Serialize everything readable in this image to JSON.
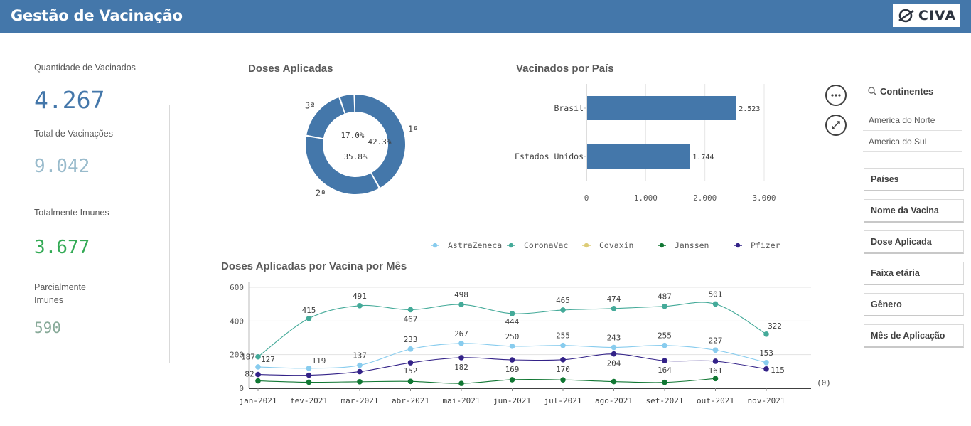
{
  "header": {
    "title": "Gestão de Vacinação",
    "logo_text": "CIVA"
  },
  "kpis": [
    {
      "label": "Quantidade de Vacinados",
      "value": "4.267",
      "color": "#4477aa"
    },
    {
      "label": "Total de Vacinações",
      "value": "9.042",
      "color": "#99bbcc"
    },
    {
      "label": "Totalmente Imunes",
      "value": "3.677",
      "color": "#33aa55"
    },
    {
      "label_line1": "Parcialmente",
      "label_line2": "Imunes",
      "value": "590",
      "color": "#88aa99"
    }
  ],
  "donut": {
    "title": "Doses Aplicadas",
    "segments": [
      {
        "label": "1ª",
        "pct_label": "42.3%",
        "value": 42.3
      },
      {
        "label": "2ª",
        "pct_label": "35.8%",
        "value": 35.8
      },
      {
        "label": "3ª",
        "pct_label": "17.0%",
        "value": 17.0
      },
      {
        "label": "",
        "pct_label": "",
        "value": 4.9
      }
    ],
    "color": "#4477aa"
  },
  "bar": {
    "title": "Vacinados por País",
    "categories": [
      "Brasil",
      "Estados Unidos"
    ],
    "values": [
      2523,
      1744
    ],
    "value_labels": [
      "2.523",
      "1.744"
    ],
    "ticks": [
      "0",
      "1.000",
      "2.000",
      "3.000"
    ],
    "tick_values": [
      0,
      1000,
      2000,
      3000
    ],
    "xlim": [
      0,
      3000
    ],
    "color": "#4477aa"
  },
  "controls": {
    "more_icon": "more-horizontal-icon",
    "expand_icon": "expand-arrows-icon"
  },
  "filters": {
    "continents_title": "Continentes",
    "search_icon": "search-icon",
    "continents": [
      "America do Norte",
      "America do Sul"
    ],
    "dimensions": [
      "Países",
      "Nome da Vacina",
      "Dose Aplicada",
      "Faixa etária",
      "Gênero",
      "Mês de Aplicação"
    ]
  },
  "chart_data": {
    "type": "line",
    "title": "Doses Aplicadas por Vacina por Mês",
    "x": [
      "jan-2021",
      "fev-2021",
      "mar-2021",
      "abr-2021",
      "mai-2021",
      "jun-2021",
      "jul-2021",
      "ago-2021",
      "set-2021",
      "out-2021",
      "nov-2021"
    ],
    "ylim": [
      0,
      600
    ],
    "yticks": [
      0,
      200,
      400,
      600
    ],
    "y_note": "(0)",
    "series": [
      {
        "name": "AstraZeneca",
        "color": "#88ccee",
        "values": [
          127,
          119,
          137,
          233,
          267,
          250,
          255,
          243,
          255,
          227,
          153
        ],
        "labels": [
          "127",
          "119",
          "137",
          "233",
          "267",
          "250",
          "255",
          "243",
          "255",
          "227",
          "153"
        ]
      },
      {
        "name": "CoronaVac",
        "color": "#44aa99",
        "values": [
          187,
          415,
          491,
          467,
          498,
          444,
          465,
          474,
          487,
          501,
          322
        ],
        "labels": [
          "187",
          "415",
          "491",
          "467",
          "498",
          "444",
          "465",
          "474",
          "487",
          "501",
          "322"
        ]
      },
      {
        "name": "Covaxin",
        "color": "#ddcc77",
        "values": [],
        "labels": []
      },
      {
        "name": "Janssen",
        "color": "#117733",
        "values": [
          44,
          36,
          39,
          41,
          29,
          51,
          50,
          40,
          35,
          58,
          null
        ],
        "labels": []
      },
      {
        "name": "Pfizer",
        "color": "#332288",
        "values": [
          82,
          78,
          99,
          152,
          182,
          169,
          170,
          204,
          164,
          161,
          115
        ],
        "labels": [
          "82",
          "",
          "",
          "152",
          "182",
          "169",
          "170",
          "204",
          "164",
          "161",
          "115"
        ]
      }
    ],
    "grid": true,
    "legend": "top"
  }
}
